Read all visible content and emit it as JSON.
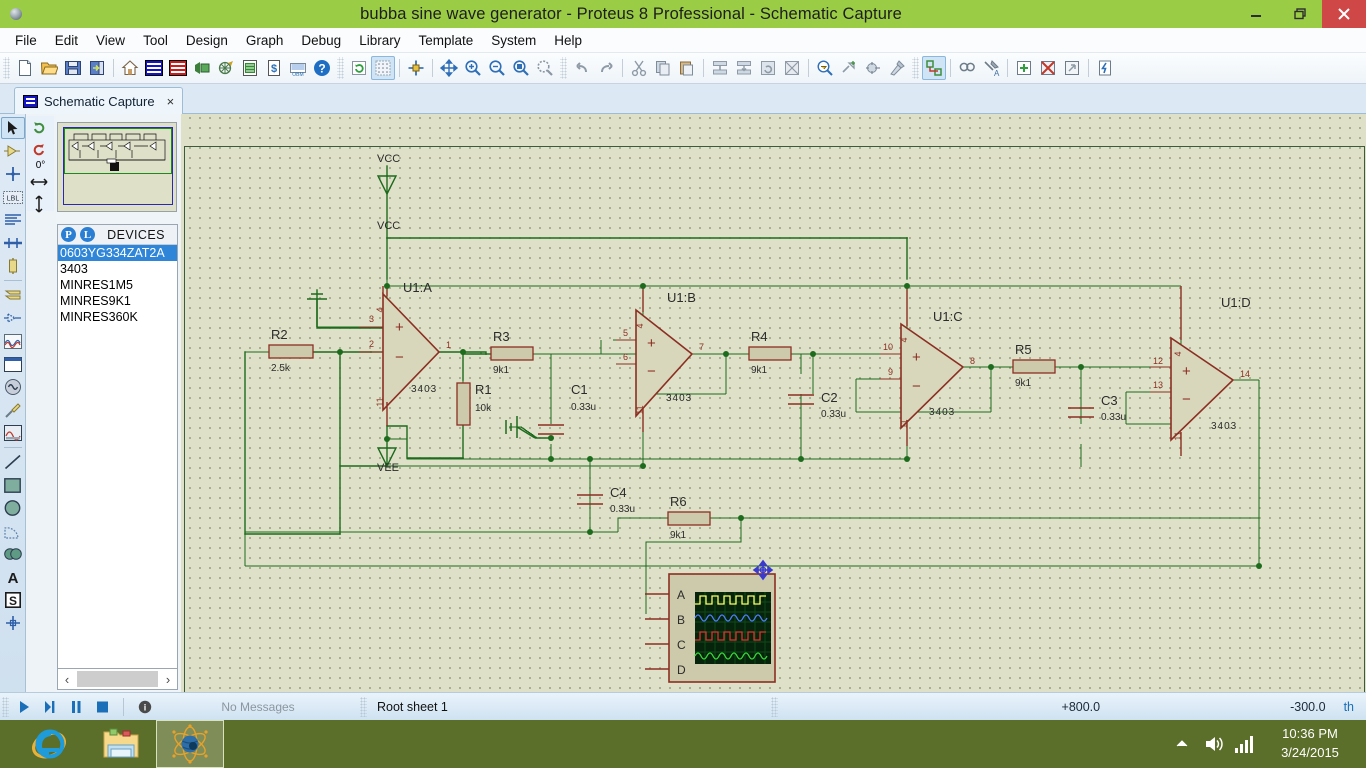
{
  "window": {
    "title": "bubba sine wave generator - Proteus 8 Professional - Schematic Capture",
    "app_icon": "proteus-globe-icon",
    "minimize_label": "Minimize",
    "maximize_label": "Restore",
    "close_label": "Close"
  },
  "menu": {
    "items": [
      {
        "label": "File"
      },
      {
        "label": "Edit"
      },
      {
        "label": "View"
      },
      {
        "label": "Tool"
      },
      {
        "label": "Design"
      },
      {
        "label": "Graph"
      },
      {
        "label": "Debug"
      },
      {
        "label": "Library"
      },
      {
        "label": "Template"
      },
      {
        "label": "System"
      },
      {
        "label": "Help"
      }
    ]
  },
  "toolbar": {
    "file_group": [
      "new-sheet-icon",
      "open-design-icon",
      "save-design-icon",
      "import-export-icon"
    ],
    "module_group": [
      "home-icon",
      "isis-schematic-icon",
      "ares-pcb-icon",
      "3d-viewer-icon",
      "gerber-viewer-icon",
      "bill-of-materials-icon",
      "design-explorer-icon",
      "report-icon",
      "help-icon"
    ],
    "view_group": [
      "refresh-icon",
      "toggle-grid-icon",
      "origin-icon",
      "pan-icon",
      "zoom-in-icon",
      "zoom-out-icon",
      "zoom-all-icon",
      "zoom-area-icon"
    ],
    "edit_group": [
      "undo-icon",
      "redo-icon",
      "cut-icon",
      "copy-icon",
      "paste-icon",
      "block-copy-icon",
      "block-move-icon",
      "block-rotate-icon",
      "block-delete-icon",
      "pick-device-icon",
      "make-device-icon",
      "packaging-tool-icon",
      "decompose-icon"
    ],
    "design_group": [
      "wire-autorouter-icon",
      "search-and-tag-icon",
      "property-assignment-icon",
      "new-sheet-add-icon",
      "remove-sheet-icon",
      "exit-sheet-icon",
      "netlist-icon"
    ]
  },
  "tab": {
    "icon": "isis-icon",
    "label": "Schematic Capture",
    "close": "×"
  },
  "tools": {
    "items": [
      {
        "name": "selection-mode-tool",
        "label": "Selection Mode",
        "selected": true
      },
      {
        "name": "component-mode-tool",
        "label": "Component Mode"
      },
      {
        "name": "junction-dot-tool",
        "label": "Junction Dot Mode"
      },
      {
        "name": "wire-label-tool",
        "label": "Wire Label Mode"
      },
      {
        "name": "text-script-tool",
        "label": "Text Script Mode"
      },
      {
        "name": "bus-tool",
        "label": "Buses Mode"
      },
      {
        "name": "subcircuit-tool",
        "label": "Subcircuit Mode"
      },
      {
        "name": "terminals-tool",
        "label": "Terminals Mode"
      },
      {
        "name": "device-pin-tool",
        "label": "Device Pins Mode"
      },
      {
        "name": "graph-tool",
        "label": "Graph Mode"
      },
      {
        "name": "tape-recorder-tool",
        "label": "Tape Recorder Mode"
      },
      {
        "name": "generator-tool",
        "label": "Generator Mode"
      },
      {
        "name": "voltage-probe-tool",
        "label": "Voltage Probe Mode"
      },
      {
        "name": "virtual-instrument-tool",
        "label": "Virtual Instruments Mode"
      },
      {
        "name": "line-tool",
        "label": "2D Graphics Line"
      },
      {
        "name": "box-tool",
        "label": "2D Graphics Box"
      },
      {
        "name": "circle-tool",
        "label": "2D Graphics Circle"
      },
      {
        "name": "arc-tool",
        "label": "2D Graphics Arc"
      },
      {
        "name": "path-tool",
        "label": "2D Graphics Closed Path"
      },
      {
        "name": "text-tool",
        "label": "2D Graphics Text"
      },
      {
        "name": "symbol-tool",
        "label": "2D Graphics Symbol"
      },
      {
        "name": "marker-tool",
        "label": "2D Graphics Markers"
      }
    ]
  },
  "orientation": {
    "rotate_cw_icon": "rotate-clockwise-icon",
    "rotate_ccw_icon": "rotate-anticlockwise-icon",
    "angle": "0°",
    "mirror_x_icon": "mirror-horizontal-icon",
    "mirror_y_icon": "mirror-vertical-icon"
  },
  "devices_panel": {
    "p_button": "P",
    "l_button": "L",
    "title": "DEVICES",
    "items": [
      {
        "label": "0603YG334ZAT2A",
        "selected": true
      },
      {
        "label": "3403",
        "selected": false
      },
      {
        "label": "MINRES1M5",
        "selected": false
      },
      {
        "label": "MINRES9K1",
        "selected": false
      },
      {
        "label": "MINRES360K",
        "selected": false
      }
    ],
    "scroll_left": "‹",
    "scroll_right": "›"
  },
  "schematic": {
    "opamps": [
      {
        "ref": "U1:A",
        "part": "3403",
        "pin_plus": "3",
        "pin_minus": "2",
        "pin_out": "1",
        "pin_vpos": "4",
        "pin_vneg": "11"
      },
      {
        "ref": "U1:B",
        "part": "3403",
        "pin_plus": "5",
        "pin_minus": "6",
        "pin_out": "7",
        "pin_vpos": "4",
        "pin_vneg": "11"
      },
      {
        "ref": "U1:C",
        "part": "3403",
        "pin_plus": "10",
        "pin_minus": "9",
        "pin_out": "8",
        "pin_vpos": "4",
        "pin_vneg": "11"
      },
      {
        "ref": "U1:D",
        "part": "3403",
        "pin_plus": "12",
        "pin_minus": "13",
        "pin_out": "14",
        "pin_vpos": "4",
        "pin_vneg": "11"
      }
    ],
    "resistors": [
      {
        "ref": "R2",
        "value": "2.5k"
      },
      {
        "ref": "R3",
        "value": "9k1"
      },
      {
        "ref": "R1",
        "value": "10k"
      },
      {
        "ref": "R4",
        "value": "9k1"
      },
      {
        "ref": "R5",
        "value": "9k1"
      },
      {
        "ref": "R6",
        "value": "9k1"
      }
    ],
    "capacitors": [
      {
        "ref": "C1",
        "value": "0.33u"
      },
      {
        "ref": "C2",
        "value": "0.33u"
      },
      {
        "ref": "C3",
        "value": "0.33u"
      },
      {
        "ref": "C4",
        "value": "0.33u"
      }
    ],
    "power_terminals": [
      {
        "label": "VCC"
      },
      {
        "label": "VEE"
      }
    ],
    "instrument": {
      "name": "oscilloscope",
      "channels": [
        "A",
        "B",
        "C",
        "D"
      ],
      "trace_colors": [
        "#ffff66",
        "#4d7fff",
        "#e03030",
        "#38d838"
      ]
    },
    "cursor": "move-crosshair-cursor"
  },
  "statusbar": {
    "play_icon": "animate-play-icon",
    "step_icon": "animate-step-icon",
    "pause_icon": "animate-pause-icon",
    "stop_icon": "animate-stop-icon",
    "info_icon": "message-info-icon",
    "messages": "No Messages",
    "sheet": "Root sheet 1",
    "coord_x": "+800.0",
    "coord_y": "-300.0",
    "units": "th"
  },
  "taskbar": {
    "items": [
      {
        "name": "internet-explorer-icon",
        "label": "Internet Explorer",
        "running": false
      },
      {
        "name": "file-explorer-icon",
        "label": "File Explorer",
        "running": false
      },
      {
        "name": "proteus-icon",
        "label": "Proteus 8 Professional",
        "running": true
      }
    ],
    "tray": {
      "show_hidden_icon": "chevron-up-icon",
      "volume_icon": "speaker-icon",
      "network_icon": "signal-bars-icon",
      "time": "10:36 PM",
      "date": "3/24/2015"
    }
  }
}
